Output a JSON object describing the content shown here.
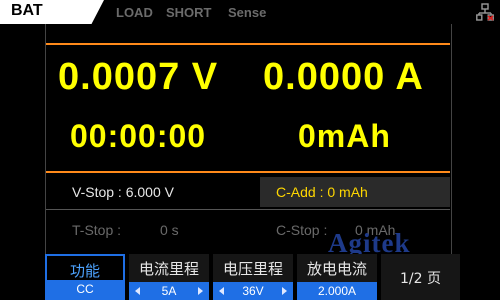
{
  "top_tabs": {
    "active": "BAT",
    "others": [
      "LOAD",
      "SHORT",
      "Sense"
    ]
  },
  "icons": {
    "network": "network-icon"
  },
  "readout": {
    "voltage": "0.0007 V",
    "current": "0.0000 A",
    "time": "00:00:00",
    "capacity": "0mAh"
  },
  "settings": {
    "v_stop": "V-Stop :  6.000 V",
    "c_add": "C-Add : 0 mAh",
    "t_stop": "T-Stop :",
    "t_stop_value": "0 s",
    "c_stop": "C-Stop :",
    "c_stop_value": "0 mAh"
  },
  "watermark": "Agitek",
  "softkeys": [
    {
      "label": "功能",
      "value": "CC",
      "selected": true
    },
    {
      "label": "电流里程",
      "value": "5A"
    },
    {
      "label": "电压里程",
      "value": "36V"
    },
    {
      "label": "放电电流",
      "value": "2.000A"
    },
    {
      "label": "1/2 页",
      "value": ""
    }
  ],
  "colors": {
    "accent_yellow": "#ffff00",
    "accent_orange": "#ff8a1a",
    "accent_blue": "#1f6fe5",
    "c_add_text": "#ffd700"
  }
}
